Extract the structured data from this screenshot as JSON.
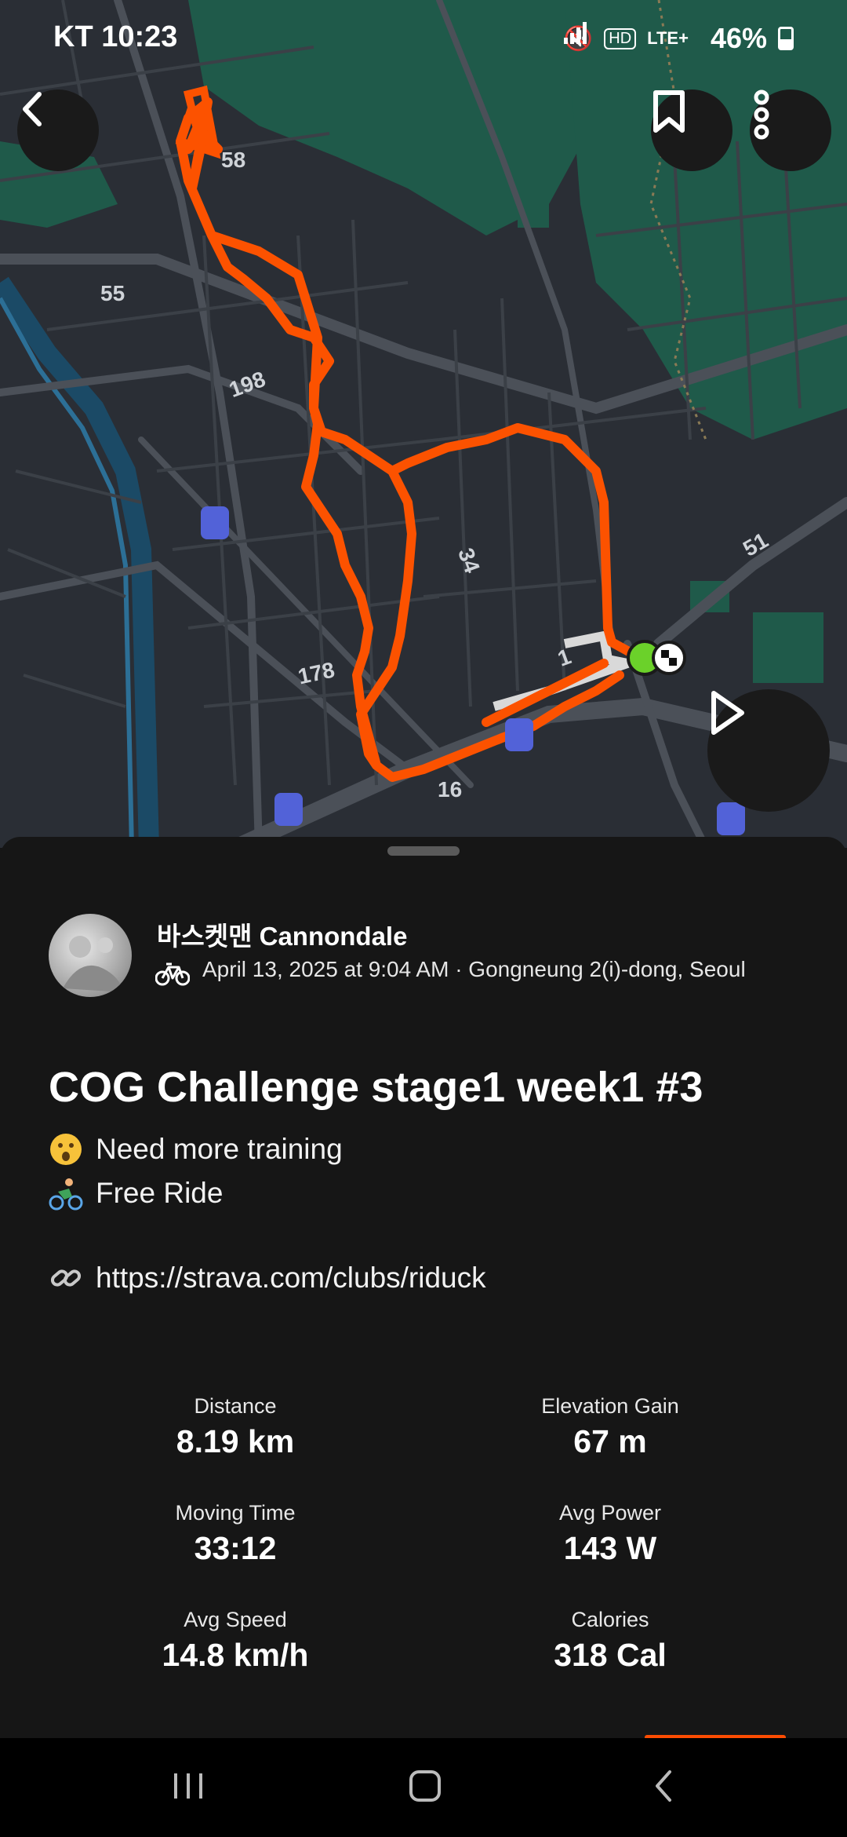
{
  "status_bar": {
    "carrier": "KT",
    "time": "10:23",
    "network": "LTE+",
    "battery": "46%"
  },
  "map": {
    "road_labels": [
      "58",
      "55",
      "198",
      "34",
      "51",
      "178",
      "16",
      "1"
    ],
    "colors": {
      "route": "#fc5200",
      "start_marker": "#6bd12a",
      "background": "#2a2e35",
      "park": "#1f5a4a"
    },
    "icons": {
      "back": "chevron-left-icon",
      "bookmark": "bookmark-icon",
      "more": "more-vertical-icon",
      "play": "play-icon",
      "transit": "subway-station-icon"
    }
  },
  "activity": {
    "athlete": "바스켓맨 Cannondale",
    "sport_icon": "bike-icon",
    "meta": "April 13, 2025 at 9:04 AM · Gongneung 2(i)-dong, Seoul",
    "title": "COG Challenge stage1 week1 #3",
    "description": [
      {
        "icon": "surprised-face-emoji",
        "text": "Need more training"
      },
      {
        "icon": "cyclist-emoji",
        "text": "Free Ride"
      },
      {
        "icon": "link-emoji",
        "text": "https://strava.com/clubs/riduck"
      }
    ]
  },
  "stats": [
    {
      "label": "Distance",
      "value": "8.19 km"
    },
    {
      "label": "Elevation Gain",
      "value": "67 m"
    },
    {
      "label": "Moving Time",
      "value": "33:12"
    },
    {
      "label": "Avg Power",
      "value": "143 W"
    },
    {
      "label": "Avg Speed",
      "value": "14.8 km/h"
    },
    {
      "label": "Calories",
      "value": "318 Cal"
    }
  ],
  "nav_bar": {
    "icons": [
      "recent-apps-icon",
      "home-icon",
      "back-icon"
    ]
  }
}
